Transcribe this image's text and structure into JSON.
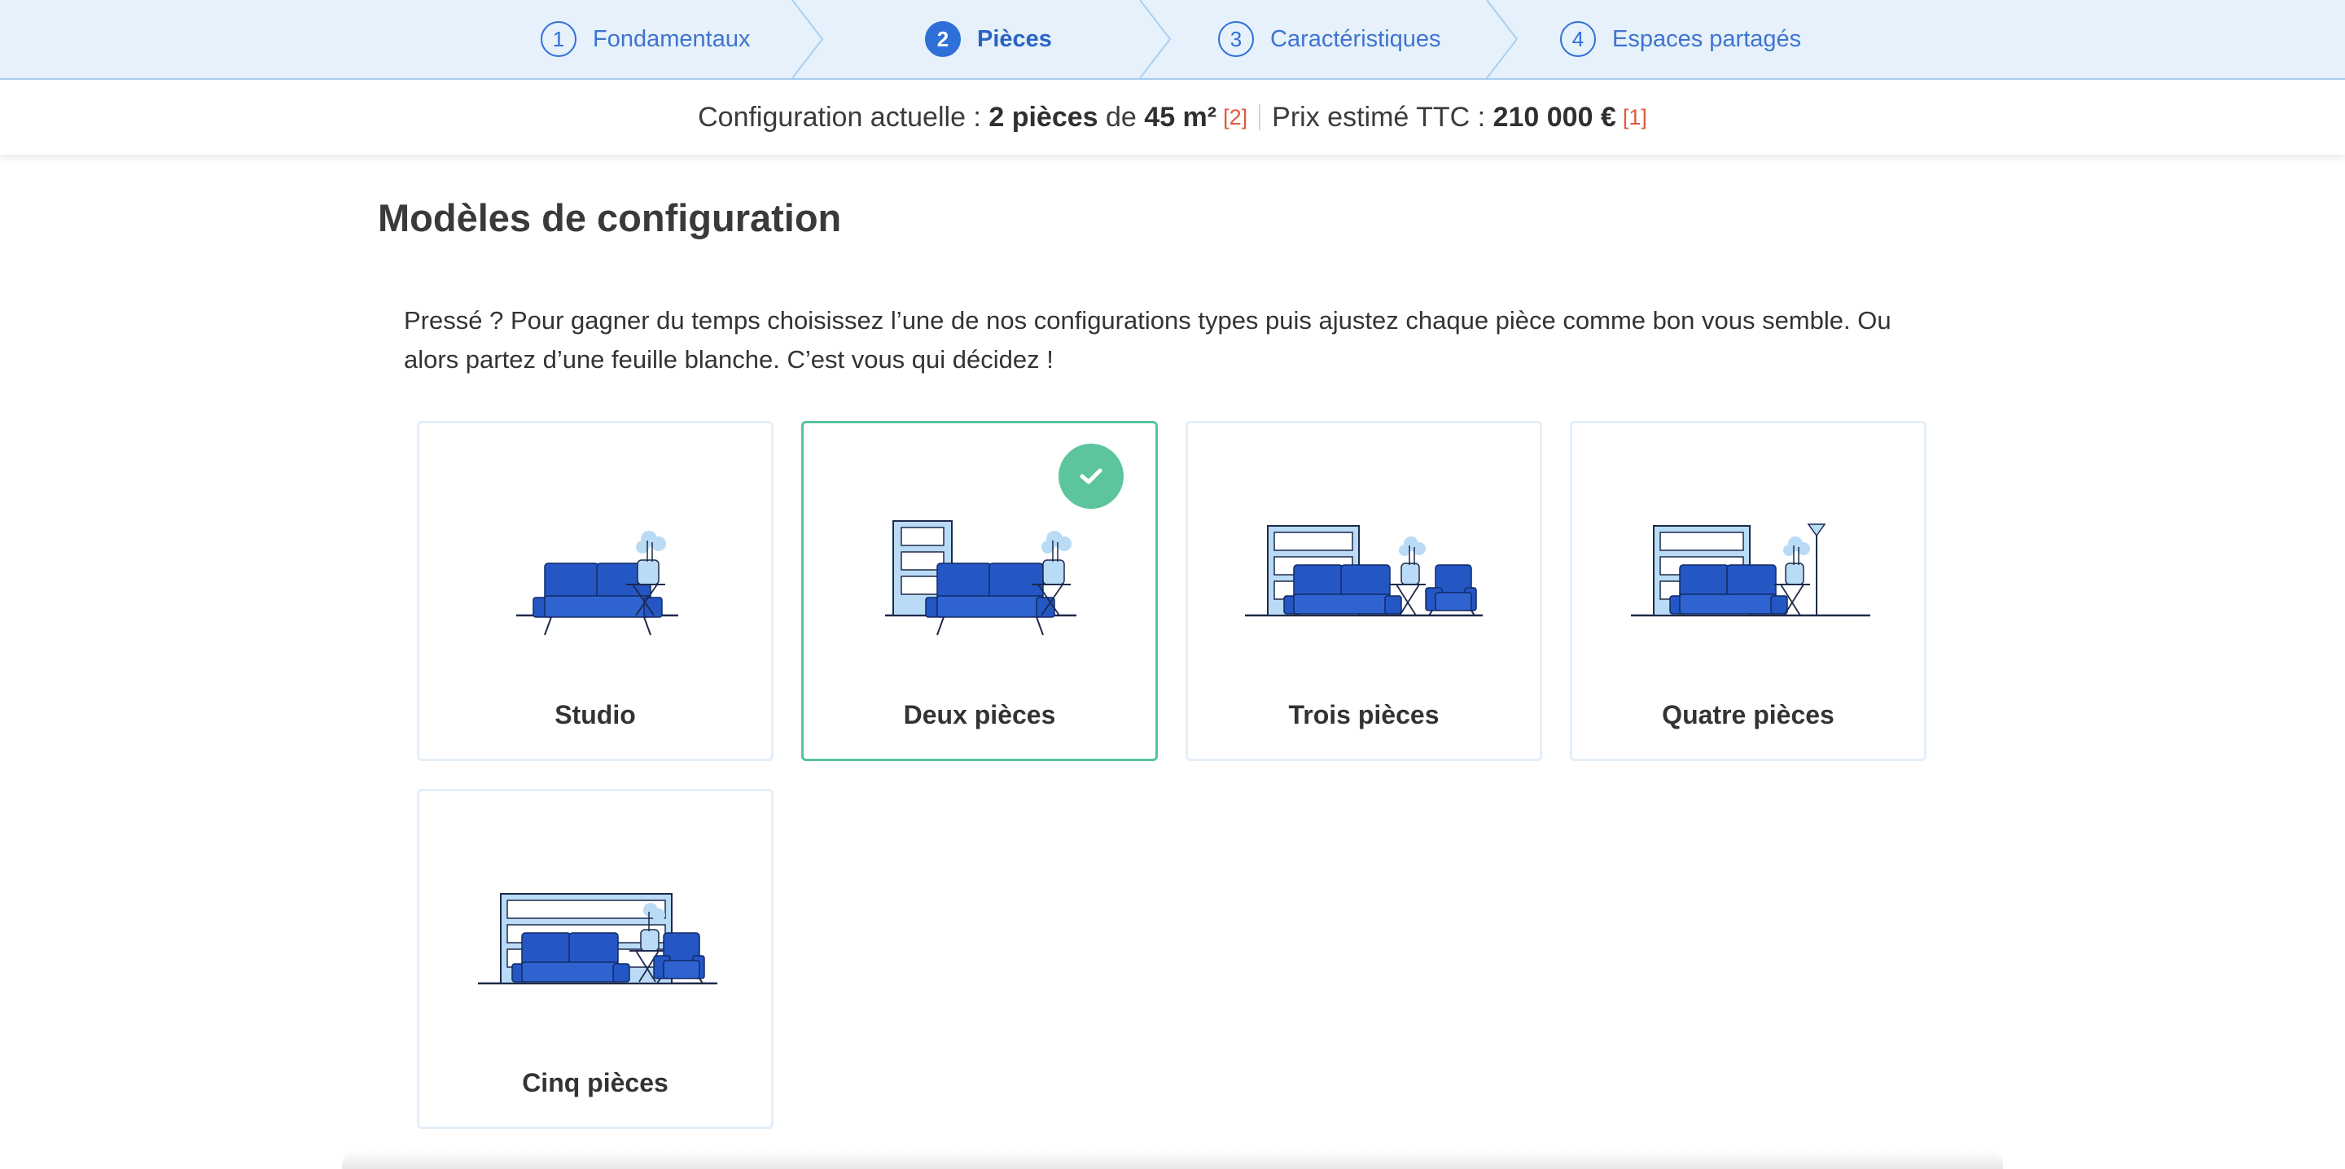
{
  "stepper": {
    "steps": [
      {
        "number": "1",
        "label": "Fondamentaux"
      },
      {
        "number": "2",
        "label": "Pièces"
      },
      {
        "number": "3",
        "label": "Caractéristiques"
      },
      {
        "number": "4",
        "label": "Espaces partagés"
      }
    ],
    "active_step": "2"
  },
  "summary": {
    "config_prefix": "Configuration actuelle :",
    "rooms": "2 pièces",
    "de": "de",
    "area": "45 m²",
    "area_ref": "[2]",
    "price_prefix": "Prix estimé TTC :",
    "price": "210 000 €",
    "price_ref": "[1]"
  },
  "main": {
    "title": "Modèles de configuration",
    "intro": "Pressé ? Pour gagner du temps choisissez l’une de nos configurations types puis ajustez chaque pièce comme bon vous semble. Ou alors partez d’une feuille blanche. C’est vous qui décidez !",
    "templates": [
      {
        "label": "Studio",
        "icon": "studio-icon",
        "selected": false
      },
      {
        "label": "Deux pièces",
        "icon": "two-room-icon",
        "selected": true
      },
      {
        "label": "Trois pièces",
        "icon": "three-room-icon",
        "selected": false
      },
      {
        "label": "Quatre pièces",
        "icon": "four-room-icon",
        "selected": false
      },
      {
        "label": "Cinq pièces",
        "icon": "five-room-icon",
        "selected": false
      }
    ]
  },
  "colors": {
    "accent": "#2f6fd8",
    "selected_border": "#56c39c",
    "check_bg": "#5cc59d",
    "ref_red": "#e2583e",
    "stepper_bg": "#e6f1fb",
    "furniture_blue": "#2456c4",
    "furniture_light": "#b9dbf6"
  }
}
